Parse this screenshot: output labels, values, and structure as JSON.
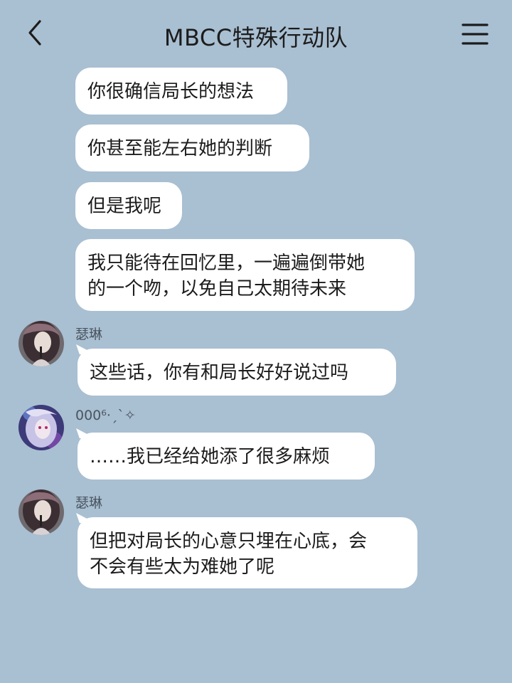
{
  "header": {
    "title": "MBCC特殊行动队"
  },
  "messages": [
    {
      "text": "你很确信局长的想法"
    },
    {
      "text": "你甚至能左右她的判断"
    },
    {
      "text": "但是我呢"
    },
    {
      "line1": "我只能待在回忆里，一遍遍倒带她",
      "line2": "的一个吻，以免自己太期待未来"
    },
    {
      "sender": "瑟琳",
      "text": "这些话，你有和局长好好说过吗"
    },
    {
      "sender": "000⁶·ˏˋ✧",
      "text": "……我已经给她添了很多麻烦"
    },
    {
      "sender": "瑟琳",
      "line1": "但把对局长的心意只埋在心底，会",
      "line2": "不会有些太为难她了呢"
    }
  ],
  "colors": {
    "background": "#a9bfd2",
    "bubble": "#ffffff",
    "text": "#1c1c1c"
  }
}
